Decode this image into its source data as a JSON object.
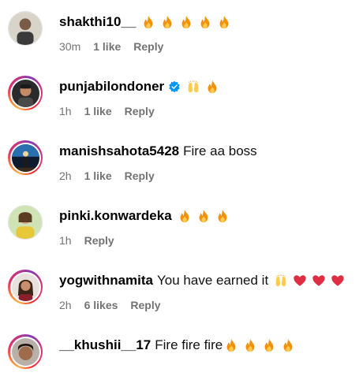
{
  "comments": [
    {
      "username": "shakthi10__",
      "text": "",
      "emojis": [
        "fire",
        "fire",
        "fire",
        "fire",
        "fire"
      ],
      "time": "30m",
      "likes": "1 like",
      "reply": "Reply"
    },
    {
      "username": "punjabilondoner",
      "verified": true,
      "text": "",
      "emojis": [
        "raised-hands",
        "fire"
      ],
      "time": "1h",
      "likes": "1 like",
      "reply": "Reply"
    },
    {
      "username": "manishsahota5428",
      "text": "Fire aa boss",
      "emojis": [],
      "time": "2h",
      "likes": "1 like",
      "reply": "Reply"
    },
    {
      "username": "pinki.konwardeka",
      "text": "",
      "emojis": [
        "fire",
        "fire",
        "fire"
      ],
      "time": "1h",
      "likes": "",
      "reply": "Reply"
    },
    {
      "username": "yogwithnamita",
      "text": "You have earned it",
      "emojis": [
        "raised-hands",
        "heart",
        "heart",
        "heart"
      ],
      "time": "2h",
      "likes": "6 likes",
      "reply": "Reply"
    },
    {
      "username": "__khushii__17",
      "text": "Fire fire fire",
      "emojis": [
        "fire",
        "fire",
        "fire",
        "fire"
      ],
      "time": "",
      "likes": "",
      "reply": ""
    }
  ],
  "colors": {
    "meta_gray": "#737373",
    "verified_blue": "#0095f6",
    "heart_red": "#e0245e",
    "fire_orange": "#f4900c"
  }
}
